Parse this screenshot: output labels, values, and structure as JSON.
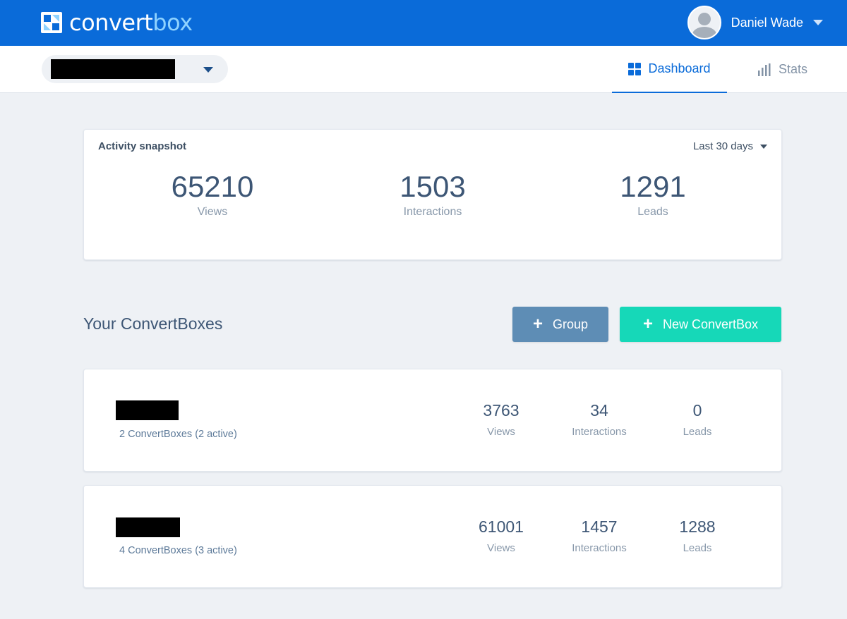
{
  "header": {
    "logo_left": "convert",
    "logo_right": "box",
    "user_name": "Daniel Wade"
  },
  "nav": {
    "tabs": [
      {
        "label": "Dashboard",
        "active": true,
        "icon": "grid-icon"
      },
      {
        "label": "Stats",
        "active": false,
        "icon": "bar-chart-icon"
      }
    ]
  },
  "snapshot": {
    "title": "Activity snapshot",
    "range": "Last 30 days",
    "stats": [
      {
        "value": "65210",
        "label": "Views"
      },
      {
        "value": "1503",
        "label": "Interactions"
      },
      {
        "value": "1291",
        "label": "Leads"
      }
    ]
  },
  "boxes": {
    "title": "Your ConvertBoxes",
    "group_button": "Group",
    "new_button": "New ConvertBox",
    "groups": [
      {
        "summary": "2 ConvertBoxes (2 active)",
        "stats": [
          {
            "value": "3763",
            "label": "Views"
          },
          {
            "value": "34",
            "label": "Interactions"
          },
          {
            "value": "0",
            "label": "Leads"
          }
        ]
      },
      {
        "summary": "4 ConvertBoxes (3 active)",
        "stats": [
          {
            "value": "61001",
            "label": "Views"
          },
          {
            "value": "1457",
            "label": "Interactions"
          },
          {
            "value": "1288",
            "label": "Leads"
          }
        ]
      }
    ]
  },
  "colors": {
    "brand_blue": "#0a6bd9",
    "accent_teal": "#16d8b8",
    "group_button": "#5e8db5"
  }
}
